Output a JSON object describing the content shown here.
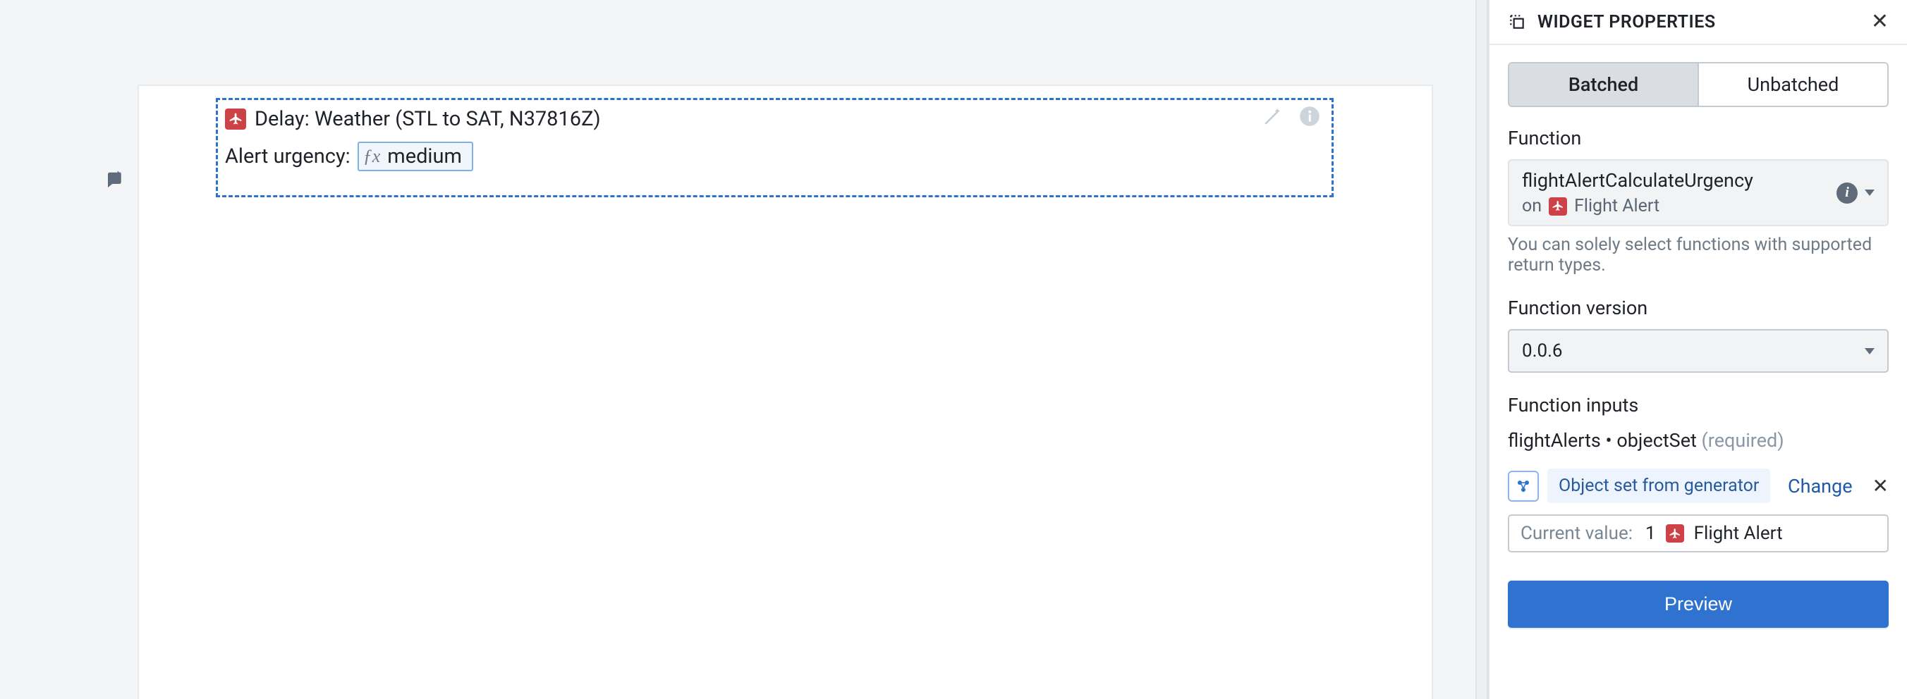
{
  "panel": {
    "title": "WIDGET PROPERTIES",
    "tabs": {
      "batched": "Batched",
      "unbatched": "Unbatched",
      "active": "batched"
    },
    "function_label": "Function",
    "function_name": "flightAlertCalculateUrgency",
    "function_on_prefix": "on",
    "function_on_type": "Flight Alert",
    "function_helper": "You can solely select functions with supported return types.",
    "version_label": "Function version",
    "version_value": "0.0.6",
    "inputs_label": "Function inputs",
    "input_param_name": "flightAlerts",
    "input_param_type": "objectSet",
    "input_param_req": "(required)",
    "object_set_chip": "Object set from generator",
    "change_label": "Change",
    "current_value_label": "Current value:",
    "current_value_count": "1",
    "current_value_type": "Flight Alert",
    "preview_label": "Preview"
  },
  "widget": {
    "title": "Delay: Weather (STL to SAT, N37816Z)",
    "urgency_label": "Alert urgency:",
    "urgency_value": "medium"
  }
}
